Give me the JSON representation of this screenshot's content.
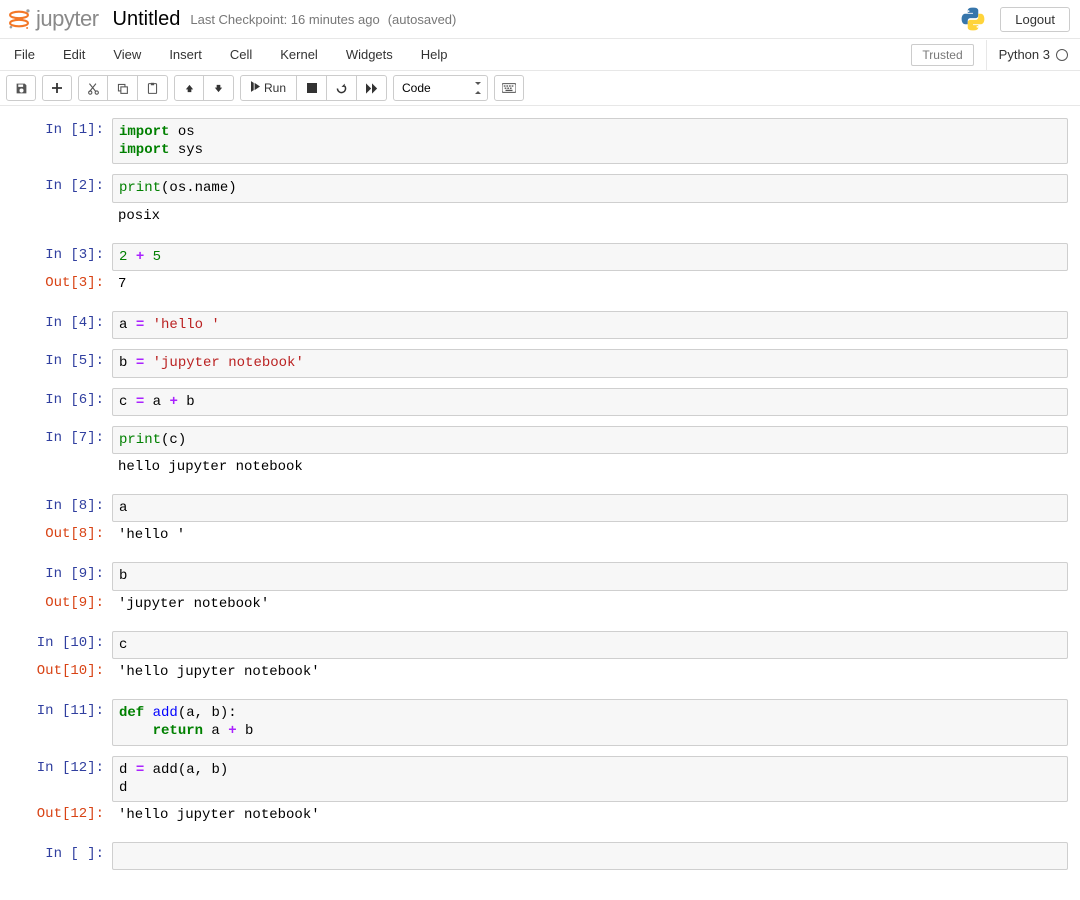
{
  "header": {
    "logo_text": "jupyter",
    "notebook_name": "Untitled",
    "checkpoint": "Last Checkpoint: 16 minutes ago",
    "autosave": "(autosaved)",
    "logout": "Logout"
  },
  "menubar": {
    "items": [
      "File",
      "Edit",
      "View",
      "Insert",
      "Cell",
      "Kernel",
      "Widgets",
      "Help"
    ],
    "trusted": "Trusted",
    "kernel_name": "Python 3"
  },
  "toolbar": {
    "run_label": "Run",
    "cell_type": "Code"
  },
  "cells": [
    {
      "n": 1,
      "in_tokens": [
        [
          "k",
          "import"
        ],
        [
          "n",
          " os\n"
        ],
        [
          "k",
          "import"
        ],
        [
          "n",
          " sys"
        ]
      ]
    },
    {
      "n": 2,
      "in_tokens": [
        [
          "nb",
          "print"
        ],
        [
          "p",
          "("
        ],
        [
          "n",
          "os.name"
        ],
        [
          "p",
          ")"
        ]
      ],
      "stdout": "posix"
    },
    {
      "n": 3,
      "in_tokens": [
        [
          "mi",
          "2"
        ],
        [
          "n",
          " "
        ],
        [
          "o",
          "+"
        ],
        [
          "n",
          " "
        ],
        [
          "mi",
          "5"
        ]
      ],
      "out": "7"
    },
    {
      "n": 4,
      "in_tokens": [
        [
          "n",
          "a "
        ],
        [
          "o",
          "="
        ],
        [
          "n",
          " "
        ],
        [
          "s",
          "'hello '"
        ]
      ]
    },
    {
      "n": 5,
      "in_tokens": [
        [
          "n",
          "b "
        ],
        [
          "o",
          "="
        ],
        [
          "n",
          " "
        ],
        [
          "s",
          "'jupyter notebook'"
        ]
      ]
    },
    {
      "n": 6,
      "in_tokens": [
        [
          "n",
          "c "
        ],
        [
          "o",
          "="
        ],
        [
          "n",
          " a "
        ],
        [
          "o",
          "+"
        ],
        [
          "n",
          " b"
        ]
      ]
    },
    {
      "n": 7,
      "in_tokens": [
        [
          "nb",
          "print"
        ],
        [
          "p",
          "("
        ],
        [
          "n",
          "c"
        ],
        [
          "p",
          ")"
        ]
      ],
      "stdout": "hello jupyter notebook"
    },
    {
      "n": 8,
      "in_tokens": [
        [
          "n",
          "a"
        ]
      ],
      "out": "'hello '"
    },
    {
      "n": 9,
      "in_tokens": [
        [
          "n",
          "b"
        ]
      ],
      "out": "'jupyter notebook'"
    },
    {
      "n": 10,
      "in_tokens": [
        [
          "n",
          "c"
        ]
      ],
      "out": "'hello jupyter notebook'"
    },
    {
      "n": 11,
      "in_tokens": [
        [
          "k",
          "def"
        ],
        [
          "n",
          " "
        ],
        [
          "fn",
          "add"
        ],
        [
          "p",
          "("
        ],
        [
          "n",
          "a, b"
        ],
        [
          "p",
          ")"
        ],
        [
          "n",
          ":\n    "
        ],
        [
          "k",
          "return"
        ],
        [
          "n",
          " a "
        ],
        [
          "o",
          "+"
        ],
        [
          "n",
          " b"
        ]
      ]
    },
    {
      "n": 12,
      "in_tokens": [
        [
          "n",
          "d "
        ],
        [
          "o",
          "="
        ],
        [
          "n",
          " add"
        ],
        [
          "p",
          "("
        ],
        [
          "n",
          "a, b"
        ],
        [
          "p",
          ")"
        ],
        [
          "n",
          "\nd"
        ]
      ],
      "out": "'hello jupyter notebook'"
    },
    {
      "n": null,
      "in_tokens": []
    }
  ]
}
